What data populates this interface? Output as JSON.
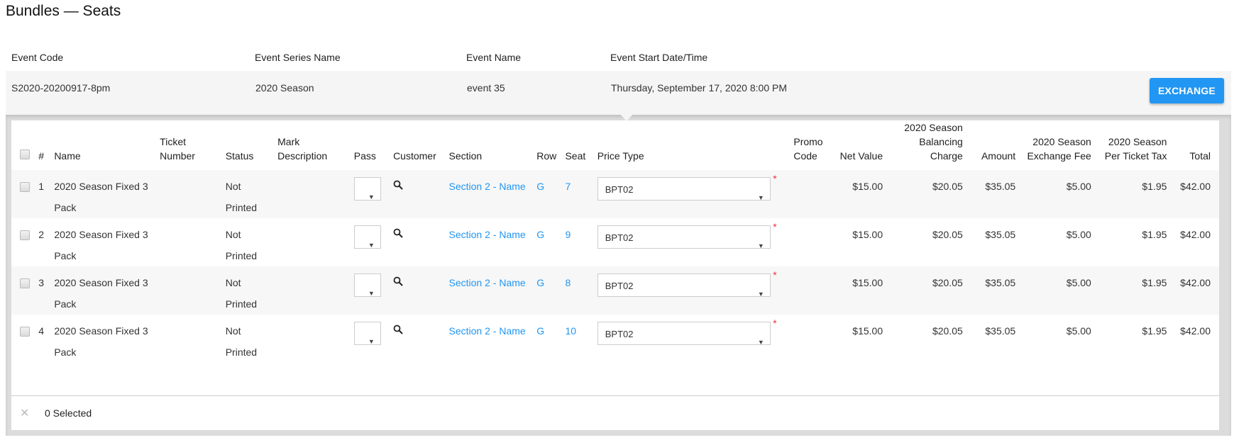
{
  "page": {
    "title": "Bundles — Seats"
  },
  "event": {
    "labels": {
      "code": "Event Code",
      "series": "Event Series Name",
      "name": "Event Name",
      "start": "Event Start Date/Time"
    },
    "values": {
      "code": "S2020-20200917-8pm",
      "series": "2020 Season",
      "name": "event 35",
      "start": "Thursday, September 17, 2020 8:00 PM"
    },
    "exchange_button": "EXCHANGE"
  },
  "colors": {
    "accent": "#2196f3",
    "required": "#e53935"
  },
  "table": {
    "headers": {
      "num": "#",
      "name": "Name",
      "ticket_number": "Ticket Number",
      "status": "Status",
      "mark_description": "Mark Description",
      "pass": "Pass",
      "customer": "Customer",
      "section": "Section",
      "row": "Row",
      "seat": "Seat",
      "price_type": "Price Type",
      "promo_code": "Promo Code",
      "net_value": "Net Value",
      "balancing_charge": "2020 Season Balancing Charge",
      "amount": "Amount",
      "exchange_fee": "2020 Season Exchange Fee",
      "per_ticket_tax": "2020 Season Per Ticket Tax",
      "total": "Total"
    },
    "rows": [
      {
        "num": "1",
        "name": "2020 Season Fixed 3 Pack",
        "ticket_number": "",
        "status": "Not Printed",
        "mark_description": "",
        "pass": "",
        "section": "Section 2 - Name",
        "row": "G",
        "seat": "7",
        "price_type": "BPT02",
        "promo_code": "",
        "net_value": "$15.00",
        "balancing_charge": "$20.05",
        "amount": "$35.05",
        "exchange_fee": "$5.00",
        "per_ticket_tax": "$1.95",
        "total": "$42.00"
      },
      {
        "num": "2",
        "name": "2020 Season Fixed 3 Pack",
        "ticket_number": "",
        "status": "Not Printed",
        "mark_description": "",
        "pass": "",
        "section": "Section 2 - Name",
        "row": "G",
        "seat": "9",
        "price_type": "BPT02",
        "promo_code": "",
        "net_value": "$15.00",
        "balancing_charge": "$20.05",
        "amount": "$35.05",
        "exchange_fee": "$5.00",
        "per_ticket_tax": "$1.95",
        "total": "$42.00"
      },
      {
        "num": "3",
        "name": "2020 Season Fixed 3 Pack",
        "ticket_number": "",
        "status": "Not Printed",
        "mark_description": "",
        "pass": "",
        "section": "Section 2 - Name",
        "row": "G",
        "seat": "8",
        "price_type": "BPT02",
        "promo_code": "",
        "net_value": "$15.00",
        "balancing_charge": "$20.05",
        "amount": "$35.05",
        "exchange_fee": "$5.00",
        "per_ticket_tax": "$1.95",
        "total": "$42.00"
      },
      {
        "num": "4",
        "name": "2020 Season Fixed 3 Pack",
        "ticket_number": "",
        "status": "Not Printed",
        "mark_description": "",
        "pass": "",
        "section": "Section 2 - Name",
        "row": "G",
        "seat": "10",
        "price_type": "BPT02",
        "promo_code": "",
        "net_value": "$15.00",
        "balancing_charge": "$20.05",
        "amount": "$35.05",
        "exchange_fee": "$5.00",
        "per_ticket_tax": "$1.95",
        "total": "$42.00"
      }
    ]
  },
  "footer": {
    "selected_text": "0 Selected",
    "clear_icon": "close-icon"
  }
}
